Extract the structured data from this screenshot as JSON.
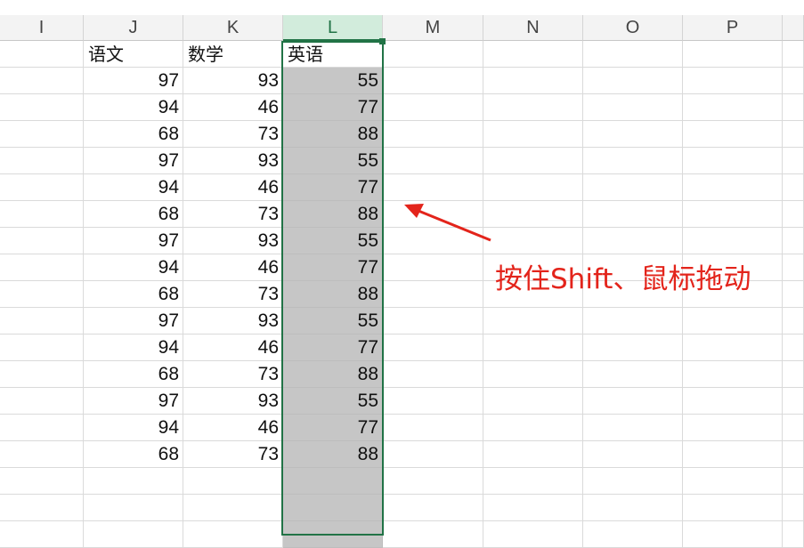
{
  "columns": [
    {
      "label": "I"
    },
    {
      "label": "J"
    },
    {
      "label": "K"
    },
    {
      "label": "L",
      "selected": true
    },
    {
      "label": "M"
    },
    {
      "label": "N"
    },
    {
      "label": "O"
    },
    {
      "label": "P"
    }
  ],
  "headers": {
    "J": "语文",
    "K": "数学",
    "L": "英语"
  },
  "rows": [
    {
      "J": "97",
      "K": "93",
      "L": "55"
    },
    {
      "J": "94",
      "K": "46",
      "L": "77"
    },
    {
      "J": "68",
      "K": "73",
      "L": "88"
    },
    {
      "J": "97",
      "K": "93",
      "L": "55"
    },
    {
      "J": "94",
      "K": "46",
      "L": "77"
    },
    {
      "J": "68",
      "K": "73",
      "L": "88"
    },
    {
      "J": "97",
      "K": "93",
      "L": "55"
    },
    {
      "J": "94",
      "K": "46",
      "L": "77"
    },
    {
      "J": "68",
      "K": "73",
      "L": "88"
    },
    {
      "J": "97",
      "K": "93",
      "L": "55"
    },
    {
      "J": "94",
      "K": "46",
      "L": "77"
    },
    {
      "J": "68",
      "K": "73",
      "L": "88"
    },
    {
      "J": "97",
      "K": "93",
      "L": "55"
    },
    {
      "J": "94",
      "K": "46",
      "L": "77"
    },
    {
      "J": "68",
      "K": "73",
      "L": "88"
    }
  ],
  "annotation": {
    "text": "按住Shift、鼠标拖动",
    "color": "#e3241b"
  },
  "colors": {
    "selection": "#217346",
    "highlight": "#c6c6c6",
    "selected_header": "#d2ecdc"
  }
}
